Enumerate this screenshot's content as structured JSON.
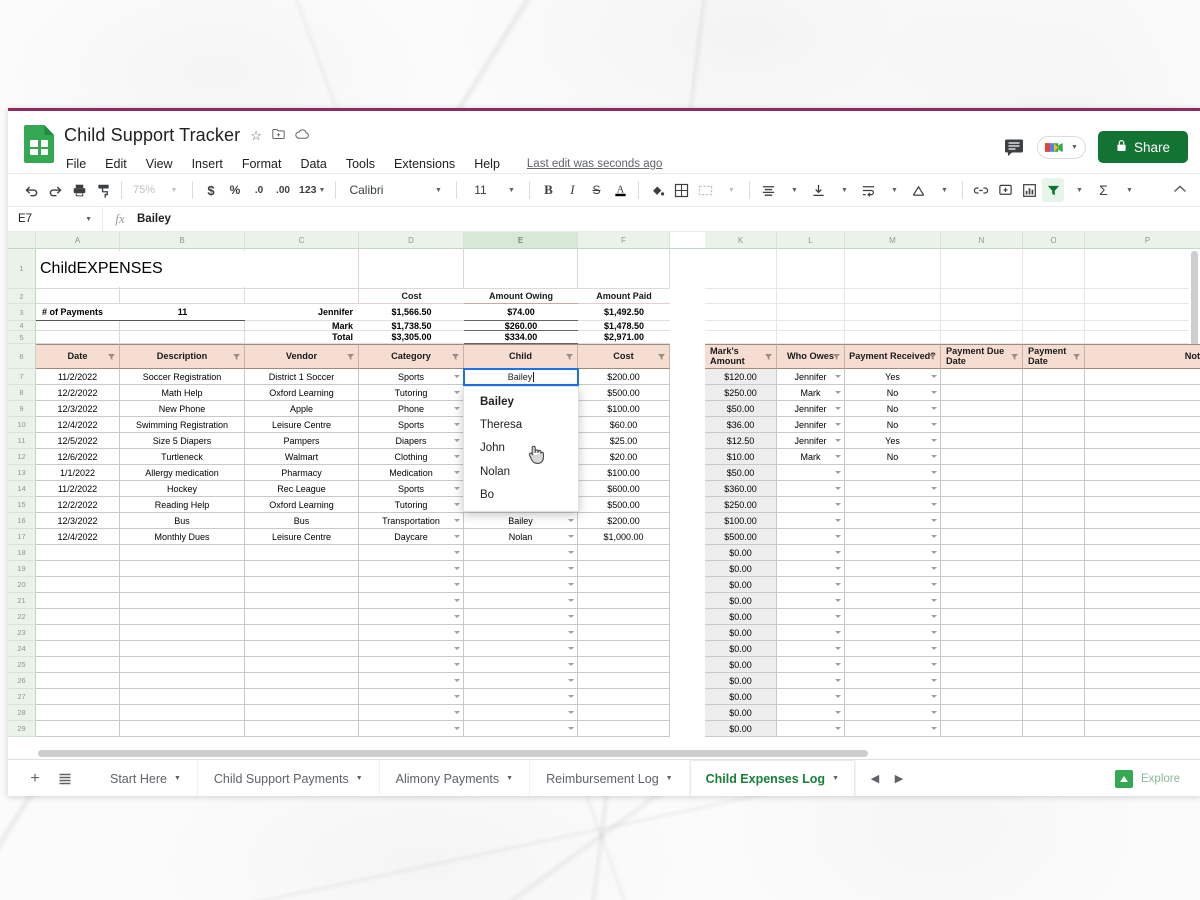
{
  "header": {
    "doc_title": "Child Support Tracker",
    "title_icons": [
      "star-icon",
      "move-to-folder-icon",
      "cloud-saved-icon"
    ],
    "menus": [
      "File",
      "Edit",
      "View",
      "Insert",
      "Format",
      "Data",
      "Tools",
      "Extensions",
      "Help"
    ],
    "last_edit": "Last edit was seconds ago",
    "share_label": "Share",
    "accent_color": "#8e2a62",
    "share_color": "#137333"
  },
  "toolbar": {
    "zoom": "75%",
    "font_name": "Calibri",
    "font_size": "11",
    "items": [
      "undo",
      "redo",
      "print",
      "paint-format",
      "zoom",
      "currency",
      "percent",
      "decrease-decimal",
      "increase-decimal",
      "more-formats",
      "bold",
      "italic",
      "strikethrough",
      "text-color",
      "fill-color",
      "borders",
      "merge-cells",
      "horizontal-align",
      "vertical-align",
      "text-wrap",
      "text-rotation",
      "insert-link",
      "insert-comment",
      "insert-chart",
      "filter",
      "functions"
    ]
  },
  "formula_bar": {
    "name_box": "E7",
    "fx": "fx",
    "value": "Bailey"
  },
  "grid": {
    "column_letters": [
      "A",
      "B",
      "C",
      "D",
      "E",
      "F"
    ],
    "column_letters_right": [
      "K",
      "L",
      "M",
      "N",
      "O",
      "P"
    ],
    "selected_column": "E",
    "row_numbers": [
      "1",
      "2",
      "3",
      "4",
      "5",
      "6",
      "7",
      "8",
      "9",
      "10",
      "11",
      "12",
      "13",
      "14",
      "15",
      "16",
      "17",
      "18",
      "19",
      "20",
      "21",
      "22",
      "23",
      "24",
      "25",
      "26",
      "27",
      "28",
      "29"
    ],
    "banner": {
      "script_word": "Child",
      "caps_word": "EXPENSES"
    },
    "payments_label": "# of Payments",
    "payments_value": "11",
    "summary": {
      "headers": [
        "Cost",
        "Amount Owing",
        "Amount Paid"
      ],
      "rows": [
        {
          "name": "Jennifer",
          "cost": "$1,566.50",
          "owing": "$74.00",
          "paid": "$1,492.50"
        },
        {
          "name": "Mark",
          "cost": "$1,738.50",
          "owing": "$260.00",
          "paid": "$1,478.50"
        },
        {
          "name": "Total",
          "cost": "$3,305.00",
          "owing": "$334.00",
          "paid": "$2,971.00"
        }
      ]
    },
    "table_headers": [
      "Date",
      "Description",
      "Vendor",
      "Category",
      "Child",
      "Cost",
      "Mark's Amount",
      "Who Owes",
      "Payment Received?",
      "Payment Due Date",
      "Payment Date",
      "Notes"
    ],
    "header_fill": "#f6ddd1",
    "rows": [
      {
        "date": "11/2/2022",
        "description": "Soccer Registration",
        "vendor": "District 1 Soccer",
        "category": "Sports",
        "child": "Bailey",
        "cost": "$200.00",
        "marks": "$120.00",
        "owes": "Jennifer",
        "received": "Yes",
        "due": "",
        "paid": "",
        "notes": ""
      },
      {
        "date": "12/2/2022",
        "description": "Math Help",
        "vendor": "Oxford Learning",
        "category": "Tutoring",
        "child": "",
        "cost": "$500.00",
        "marks": "$250.00",
        "owes": "Mark",
        "received": "No",
        "due": "",
        "paid": "",
        "notes": ""
      },
      {
        "date": "12/3/2022",
        "description": "New Phone",
        "vendor": "Apple",
        "category": "Phone",
        "child": "",
        "cost": "$100.00",
        "marks": "$50.00",
        "owes": "Jennifer",
        "received": "No",
        "due": "",
        "paid": "",
        "notes": ""
      },
      {
        "date": "12/4/2022",
        "description": "Swimming Registration",
        "vendor": "Leisure Centre",
        "category": "Sports",
        "child": "",
        "cost": "$60.00",
        "marks": "$36.00",
        "owes": "Jennifer",
        "received": "No",
        "due": "",
        "paid": "",
        "notes": ""
      },
      {
        "date": "12/5/2022",
        "description": "Size 5 Diapers",
        "vendor": "Pampers",
        "category": "Diapers",
        "child": "",
        "cost": "$25.00",
        "marks": "$12.50",
        "owes": "Jennifer",
        "received": "Yes",
        "due": "",
        "paid": "",
        "notes": ""
      },
      {
        "date": "12/6/2022",
        "description": "Turtleneck",
        "vendor": "Walmart",
        "category": "Clothing",
        "child": "",
        "cost": "$20.00",
        "marks": "$10.00",
        "owes": "Mark",
        "received": "No",
        "due": "",
        "paid": "",
        "notes": ""
      },
      {
        "date": "1/1/2022",
        "description": "Allergy medication",
        "vendor": "Pharmacy",
        "category": "Medication",
        "child": "",
        "cost": "$100.00",
        "marks": "$50.00",
        "owes": "",
        "received": "",
        "due": "",
        "paid": "",
        "notes": ""
      },
      {
        "date": "11/2/2022",
        "description": "Hockey",
        "vendor": "Rec League",
        "category": "Sports",
        "child": "",
        "cost": "$600.00",
        "marks": "$360.00",
        "owes": "",
        "received": "",
        "due": "",
        "paid": "",
        "notes": ""
      },
      {
        "date": "12/2/2022",
        "description": "Reading Help",
        "vendor": "Oxford Learning",
        "category": "Tutoring",
        "child": "",
        "cost": "$500.00",
        "marks": "$250.00",
        "owes": "",
        "received": "",
        "due": "",
        "paid": "",
        "notes": ""
      },
      {
        "date": "12/3/2022",
        "description": "Bus",
        "vendor": "Bus",
        "category": "Transportation",
        "child": "Bailey",
        "cost": "$200.00",
        "marks": "$100.00",
        "owes": "",
        "received": "",
        "due": "",
        "paid": "",
        "notes": ""
      },
      {
        "date": "12/4/2022",
        "description": "Monthly Dues",
        "vendor": "Leisure Centre",
        "category": "Daycare",
        "child": "Nolan",
        "cost": "$1,000.00",
        "marks": "$500.00",
        "owes": "",
        "received": "",
        "due": "",
        "paid": "",
        "notes": ""
      }
    ],
    "empty_row_count": 12,
    "empty_marks_value": "$0.00",
    "selected_cell": {
      "ref": "E7",
      "value": "Bailey"
    }
  },
  "child_dropdown": {
    "options": [
      "Bailey",
      "Theresa",
      "John",
      "Nolan",
      "Bo"
    ],
    "highlighted": "Bailey"
  },
  "tabbar": {
    "add_sheet": "add-sheet-icon",
    "all_sheets": "all-sheets-icon",
    "tabs": [
      {
        "label": "Start Here",
        "active": false
      },
      {
        "label": "Child Support Payments",
        "active": false
      },
      {
        "label": "Alimony Payments",
        "active": false
      },
      {
        "label": "Reimbursement Log",
        "active": false
      },
      {
        "label": "Child Expenses Log",
        "active": true
      }
    ],
    "explore_label": "Explore"
  }
}
